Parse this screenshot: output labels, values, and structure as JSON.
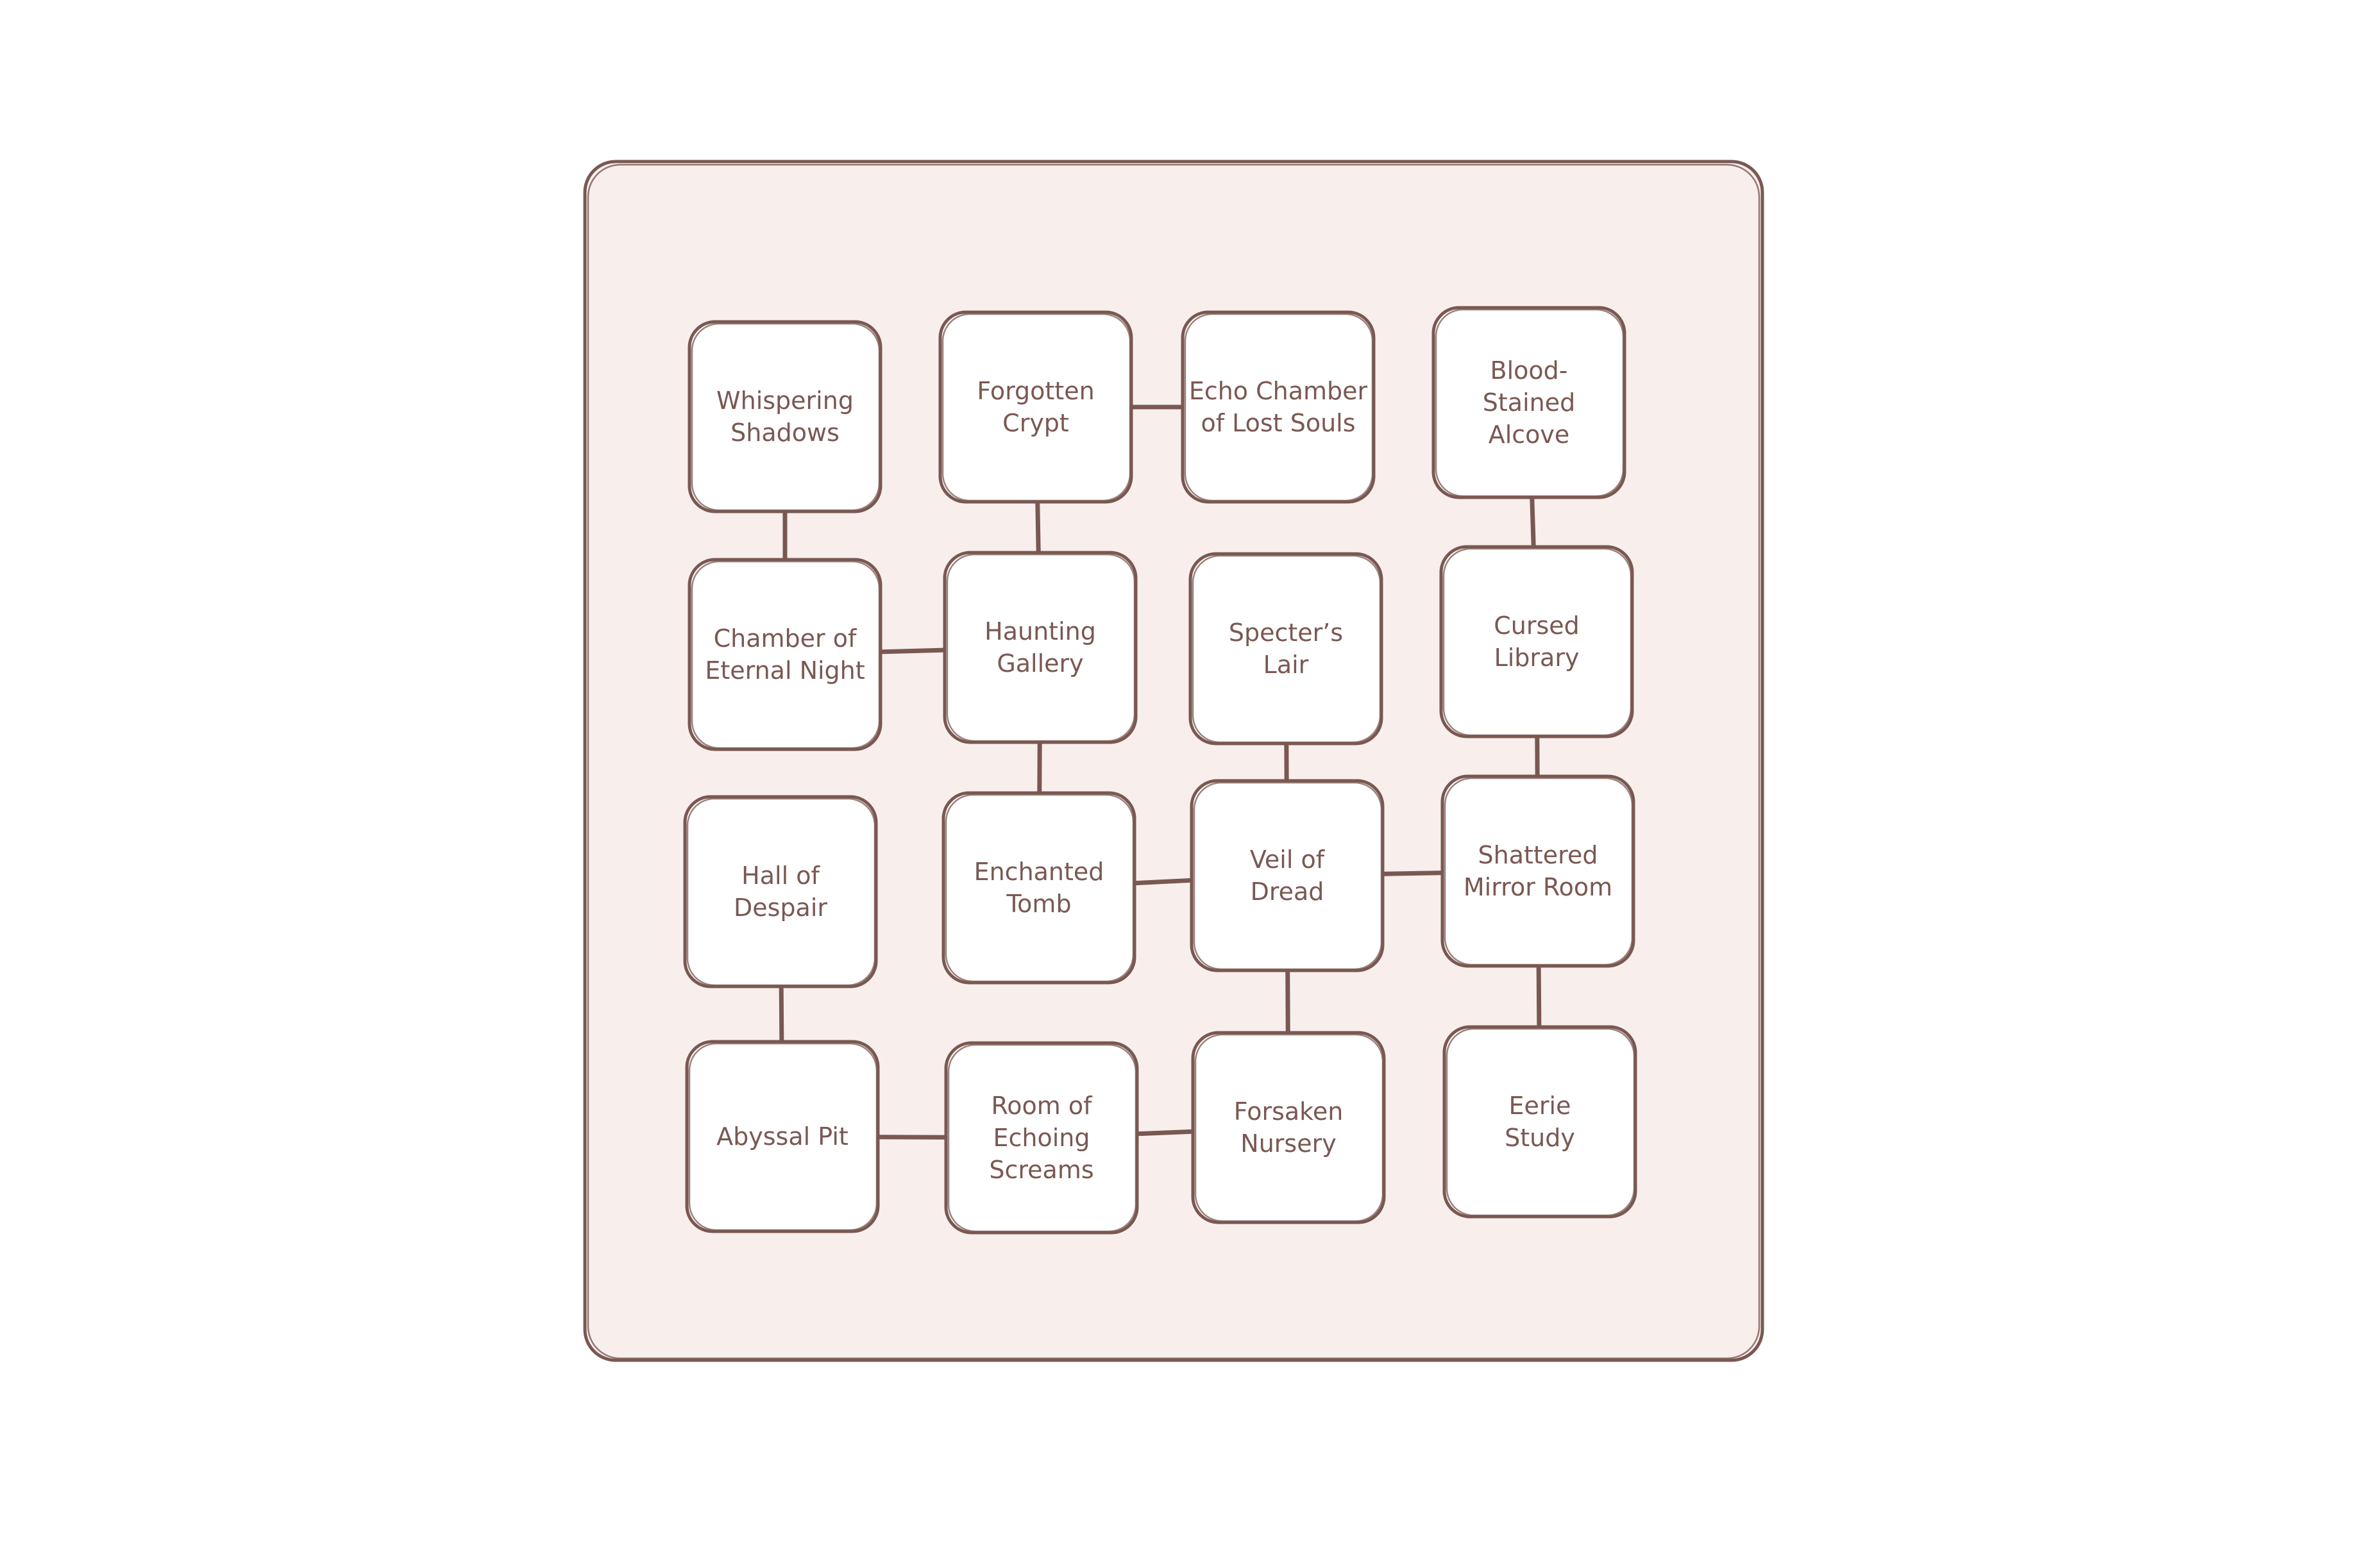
{
  "colors": {
    "stroke": "#7a5852",
    "frame_fill": "#f8efed",
    "room_fill": "#ffffff",
    "label": "#7a5852"
  },
  "rooms": [
    {
      "id": "whispering-shadows",
      "lines": [
        "Whispering",
        "Shadows"
      ]
    },
    {
      "id": "forgotten-crypt",
      "lines": [
        "Forgotten",
        "Crypt"
      ]
    },
    {
      "id": "echo-chamber-of-lost-souls",
      "lines": [
        "Echo Chamber",
        "of Lost Souls"
      ]
    },
    {
      "id": "blood-stained-alcove",
      "lines": [
        "Blood-",
        "Stained",
        "Alcove"
      ]
    },
    {
      "id": "chamber-of-eternal-night",
      "lines": [
        "Chamber of",
        "Eternal Night"
      ]
    },
    {
      "id": "haunting-gallery",
      "lines": [
        "Haunting",
        "Gallery"
      ]
    },
    {
      "id": "specters-lair",
      "lines": [
        "Specter’s",
        "Lair"
      ]
    },
    {
      "id": "cursed-library",
      "lines": [
        "Cursed",
        "Library"
      ]
    },
    {
      "id": "hall-of-despair",
      "lines": [
        "Hall of",
        "Despair"
      ]
    },
    {
      "id": "enchanted-tomb",
      "lines": [
        "Enchanted",
        "Tomb"
      ]
    },
    {
      "id": "veil-of-dread",
      "lines": [
        "Veil of",
        "Dread"
      ]
    },
    {
      "id": "shattered-mirror-room",
      "lines": [
        "Shattered",
        "Mirror Room"
      ]
    },
    {
      "id": "abyssal-pit",
      "lines": [
        "Abyssal Pit"
      ]
    },
    {
      "id": "room-of-echoing-screams",
      "lines": [
        "Room of",
        "Echoing",
        "Screams"
      ]
    },
    {
      "id": "forsaken-nursery",
      "lines": [
        "Forsaken",
        "Nursery"
      ]
    },
    {
      "id": "eerie-study",
      "lines": [
        "Eerie",
        "Study"
      ]
    }
  ],
  "connections": [
    [
      "whispering-shadows",
      "chamber-of-eternal-night"
    ],
    [
      "forgotten-crypt",
      "echo-chamber-of-lost-souls"
    ],
    [
      "forgotten-crypt",
      "haunting-gallery"
    ],
    [
      "blood-stained-alcove",
      "cursed-library"
    ],
    [
      "chamber-of-eternal-night",
      "haunting-gallery"
    ],
    [
      "haunting-gallery",
      "enchanted-tomb"
    ],
    [
      "specters-lair",
      "veil-of-dread"
    ],
    [
      "cursed-library",
      "shattered-mirror-room"
    ],
    [
      "hall-of-despair",
      "abyssal-pit"
    ],
    [
      "enchanted-tomb",
      "veil-of-dread"
    ],
    [
      "veil-of-dread",
      "shattered-mirror-room"
    ],
    [
      "veil-of-dread",
      "forsaken-nursery"
    ],
    [
      "shattered-mirror-room",
      "eerie-study"
    ],
    [
      "abyssal-pit",
      "room-of-echoing-screams"
    ],
    [
      "room-of-echoing-screams",
      "forsaken-nursery"
    ]
  ]
}
